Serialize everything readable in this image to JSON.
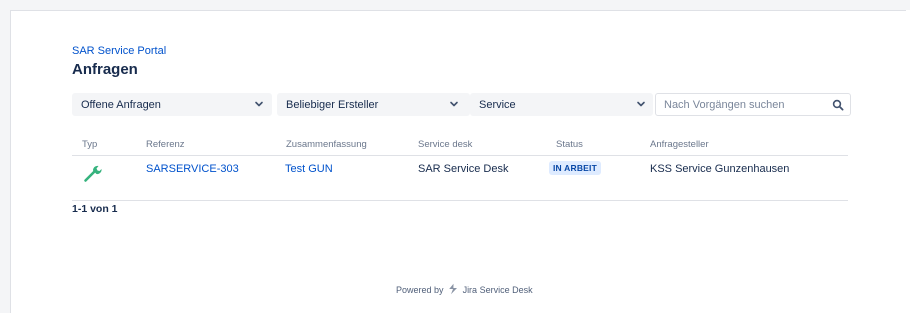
{
  "breadcrumb": "SAR Service Portal",
  "page_title": "Anfragen",
  "filters": {
    "status_select": "Offene Anfragen",
    "creator_select": "Beliebiger Ersteller",
    "service_select": "Service",
    "search_placeholder": "Nach Vorgängen suchen"
  },
  "table": {
    "headers": {
      "type": "Typ",
      "reference": "Referenz",
      "summary": "Zusammenfassung",
      "service_desk": "Service desk",
      "status": "Status",
      "requester": "Anfragesteller"
    },
    "rows": [
      {
        "type_icon": "wrench-icon",
        "reference": "SARSERVICE-303",
        "summary": "Test GUN",
        "service_desk": "SAR Service Desk",
        "status": "IN ARBEIT",
        "requester": "KSS Service Gunzenhausen"
      }
    ]
  },
  "pagination": "1-1 von 1",
  "footer": {
    "powered_by": "Powered by",
    "product": "Jira Service Desk"
  },
  "colors": {
    "link": "#0052cc",
    "status_bg": "#deebff",
    "status_text": "#0747a6",
    "wrench": "#36b37e"
  }
}
